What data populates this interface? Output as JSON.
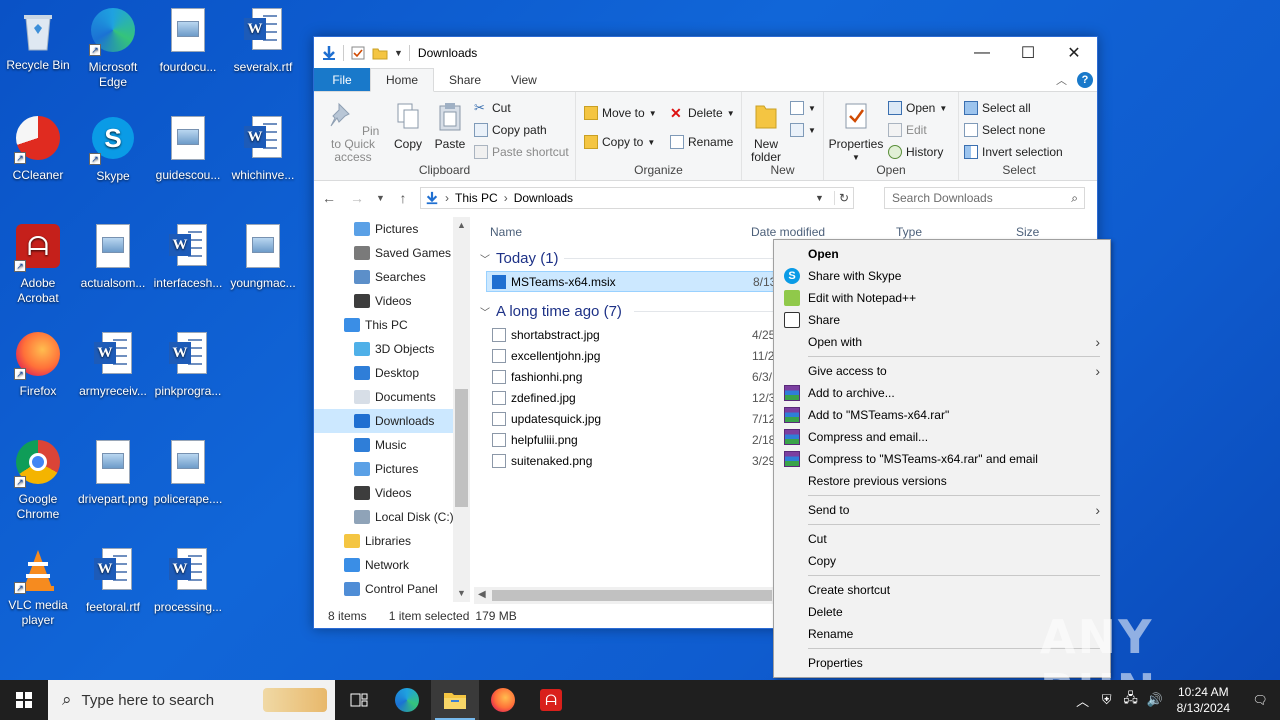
{
  "desktop": {
    "icons": [
      {
        "label": "Recycle Bin",
        "type": "recycle-bin"
      },
      {
        "label": "Microsoft Edge",
        "type": "edge"
      },
      {
        "label": "fourdocu...",
        "type": "image-doc"
      },
      {
        "label": "severalx.rtf",
        "type": "word"
      },
      {
        "label": "CCleaner",
        "type": "ccleaner"
      },
      {
        "label": "Skype",
        "type": "skype"
      },
      {
        "label": "guidescou...",
        "type": "image-doc"
      },
      {
        "label": "whichinve...",
        "type": "word"
      },
      {
        "label": "Adobe Acrobat",
        "type": "acrobat"
      },
      {
        "label": "actualsom...",
        "type": "image-doc"
      },
      {
        "label": "interfacesh...",
        "type": "word"
      },
      {
        "label": "youngmac...",
        "type": "image-doc"
      },
      {
        "label": "Firefox",
        "type": "firefox"
      },
      {
        "label": "armyreceiv...",
        "type": "word"
      },
      {
        "label": "pinkprogra...",
        "type": "word"
      },
      {
        "label": "Google Chrome",
        "type": "chrome"
      },
      {
        "label": "drivepart.png",
        "type": "image-doc"
      },
      {
        "label": "policerape....",
        "type": "image-doc"
      },
      {
        "label": "VLC media player",
        "type": "vlc"
      },
      {
        "label": "feetoral.rtf",
        "type": "word"
      },
      {
        "label": "processing...",
        "type": "word"
      }
    ]
  },
  "explorer": {
    "title": "Downloads",
    "tabs": {
      "file": "File",
      "home": "Home",
      "share": "Share",
      "view": "View"
    },
    "ribbon": {
      "clipboard": {
        "pin": "Pin to Quick access",
        "copy": "Copy",
        "paste": "Paste",
        "cut": "Cut",
        "copy_path": "Copy path",
        "paste_shortcut": "Paste shortcut",
        "label": "Clipboard"
      },
      "organize": {
        "move_to": "Move to",
        "copy_to": "Copy to",
        "delete": "Delete",
        "rename": "Rename",
        "label": "Organize"
      },
      "new": {
        "new_folder": "New folder",
        "label": "New"
      },
      "open": {
        "properties": "Properties",
        "open": "Open",
        "edit": "Edit",
        "history": "History",
        "label": "Open"
      },
      "select": {
        "select_all": "Select all",
        "select_none": "Select none",
        "invert": "Invert selection",
        "label": "Select"
      }
    },
    "address": {
      "crumbs": [
        "This PC",
        "Downloads"
      ],
      "search_placeholder": "Search Downloads"
    },
    "nav_items": [
      {
        "label": "Pictures",
        "indent": 1,
        "icon": "pictures"
      },
      {
        "label": "Saved Games",
        "indent": 1,
        "icon": "games"
      },
      {
        "label": "Searches",
        "indent": 1,
        "icon": "searches"
      },
      {
        "label": "Videos",
        "indent": 1,
        "icon": "videos"
      },
      {
        "label": "This PC",
        "indent": 0,
        "icon": "pc"
      },
      {
        "label": "3D Objects",
        "indent": 1,
        "icon": "3d"
      },
      {
        "label": "Desktop",
        "indent": 1,
        "icon": "desktop"
      },
      {
        "label": "Documents",
        "indent": 1,
        "icon": "documents"
      },
      {
        "label": "Downloads",
        "indent": 1,
        "icon": "downloads",
        "selected": true
      },
      {
        "label": "Music",
        "indent": 1,
        "icon": "music"
      },
      {
        "label": "Pictures",
        "indent": 1,
        "icon": "pictures"
      },
      {
        "label": "Videos",
        "indent": 1,
        "icon": "videos"
      },
      {
        "label": "Local Disk (C:)",
        "indent": 1,
        "icon": "disk"
      },
      {
        "label": "Libraries",
        "indent": 0,
        "icon": "libraries"
      },
      {
        "label": "Network",
        "indent": 0,
        "icon": "network"
      },
      {
        "label": "Control Panel",
        "indent": 0,
        "icon": "control-panel"
      }
    ],
    "columns": {
      "name": "Name",
      "date": "Date modified",
      "type": "Type",
      "size": "Size"
    },
    "groups": [
      {
        "title": "Today (1)",
        "files": [
          {
            "name": "MSTeams-x64.msix",
            "date": "8/13",
            "selected": true
          }
        ]
      },
      {
        "title": "A long time ago (7)",
        "files": [
          {
            "name": "shortabstract.jpg",
            "date": "4/25"
          },
          {
            "name": "excellentjohn.jpg",
            "date": "11/2"
          },
          {
            "name": "fashionhi.png",
            "date": "6/3/"
          },
          {
            "name": "zdefined.jpg",
            "date": "12/3"
          },
          {
            "name": "updatesquick.jpg",
            "date": "7/12"
          },
          {
            "name": "helpfuliii.png",
            "date": "2/18"
          },
          {
            "name": "suitenaked.png",
            "date": "3/29"
          }
        ]
      }
    ],
    "status": {
      "count": "8 items",
      "selection": "1 item selected",
      "size": "179 MB"
    }
  },
  "context_menu": {
    "sections": [
      [
        {
          "label": "Open",
          "bold": true,
          "icon": ""
        },
        {
          "label": "Share with Skype",
          "icon": "skype"
        },
        {
          "label": "Edit with Notepad++",
          "icon": "notepadpp"
        },
        {
          "label": "Share",
          "icon": "share"
        },
        {
          "label": "Open with",
          "submenu": true,
          "icon": ""
        }
      ],
      [
        {
          "label": "Give access to",
          "submenu": true,
          "icon": ""
        },
        {
          "label": "Add to archive...",
          "icon": "winrar"
        },
        {
          "label": "Add to \"MSTeams-x64.rar\"",
          "icon": "winrar"
        },
        {
          "label": "Compress and email...",
          "icon": "winrar"
        },
        {
          "label": "Compress to \"MSTeams-x64.rar\" and email",
          "icon": "winrar"
        },
        {
          "label": "Restore previous versions",
          "icon": ""
        }
      ],
      [
        {
          "label": "Send to",
          "submenu": true,
          "icon": ""
        }
      ],
      [
        {
          "label": "Cut",
          "icon": ""
        },
        {
          "label": "Copy",
          "icon": ""
        }
      ],
      [
        {
          "label": "Create shortcut",
          "icon": ""
        },
        {
          "label": "Delete",
          "icon": ""
        },
        {
          "label": "Rename",
          "icon": ""
        }
      ],
      [
        {
          "label": "Properties",
          "icon": ""
        }
      ]
    ]
  },
  "taskbar": {
    "search_placeholder": "Type here to search",
    "apps": [
      "task-view",
      "edge",
      "file-explorer",
      "firefox",
      "acrobat"
    ],
    "time": "10:24 AM",
    "date": "8/13/2024"
  },
  "watermark": "ANY RUN",
  "colors": {
    "accent": "#1979ca",
    "selection": "#cce8ff",
    "desktop": "#0f5ccf",
    "taskbar": "#1f1f1f"
  }
}
